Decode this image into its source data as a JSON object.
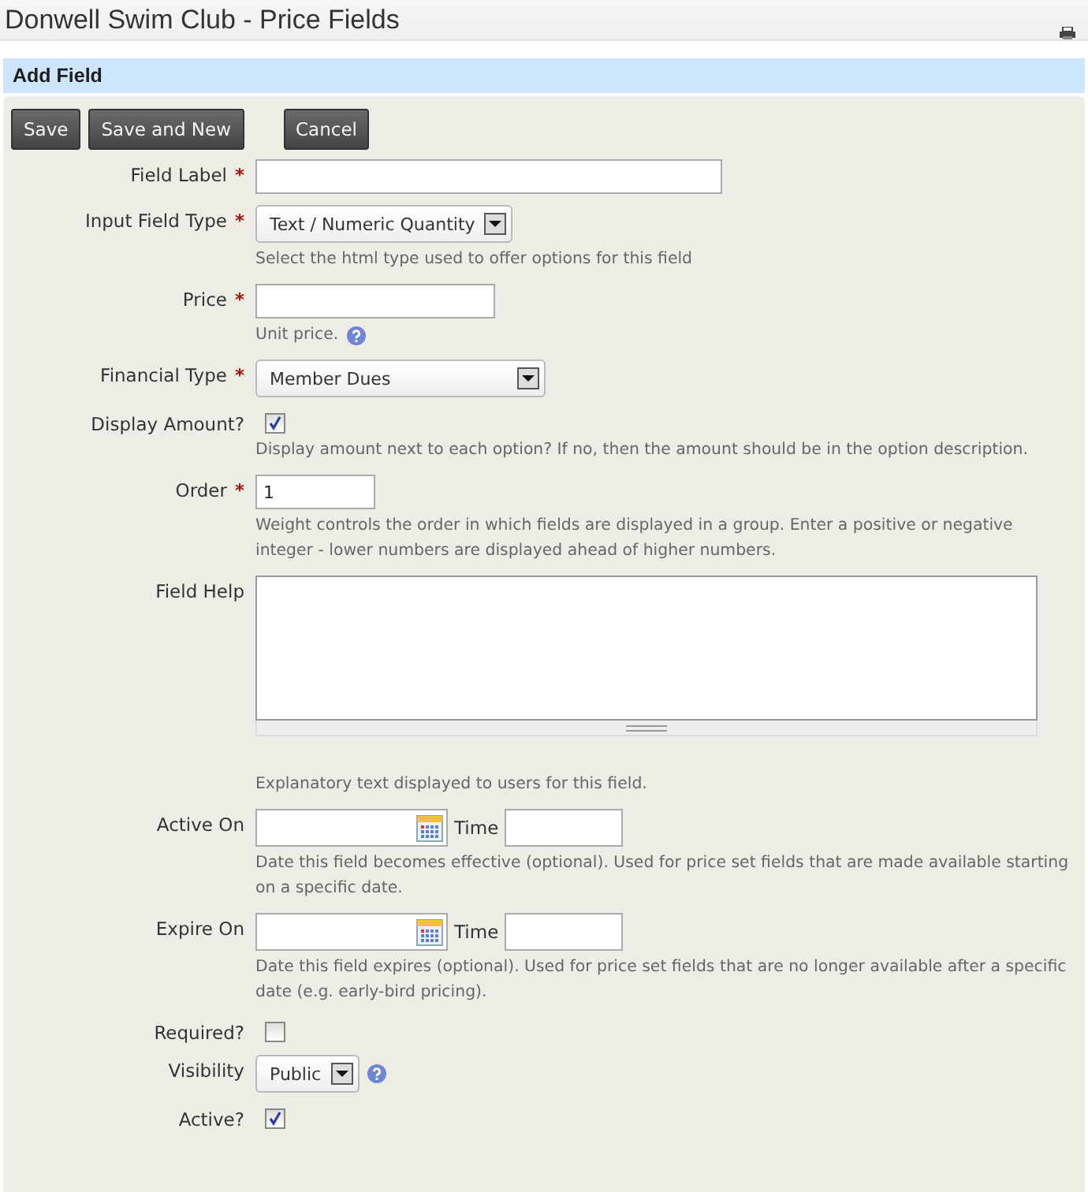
{
  "page_title": "Donwell Swim Club - Price Fields",
  "section": {
    "title": "Add Field"
  },
  "buttons": [
    {
      "label": "Save"
    },
    {
      "label": "Save and New"
    },
    {
      "label": "Cancel"
    }
  ],
  "fields": [
    {
      "label": "Field Label",
      "mark": "*",
      "kind": "long-text"
    },
    {
      "label": "Input Field Type",
      "mark": "*",
      "kind": "select",
      "value": "Text / Numeric Quantity",
      "help": "Select the html type used to offer options for this field"
    },
    {
      "label": "Price",
      "mark": "*",
      "kind": "medium-text",
      "help": "Unit price.",
      "help_icon": true
    },
    {
      "label": "Financial Type",
      "mark": "*",
      "kind": "wide-select",
      "value": "Member Dues"
    },
    {
      "label": "Display Amount?",
      "kind": "checkbox",
      "checked": true,
      "help": "Display amount next to each option? If no, then the amount should be in the option description."
    },
    {
      "label": "Order",
      "mark": "*",
      "kind": "short-text",
      "value": "1",
      "help": "Weight controls the order in which fields are displayed in a group. Enter a positive or negative integer - lower numbers are displayed ahead of higher numbers."
    },
    {
      "label": "Field Help",
      "kind": "textarea",
      "help": "Explanatory text displayed to users for this field."
    },
    {
      "label": "Active On",
      "kind": "datetime",
      "time_label": "Time",
      "help": "Date this field becomes effective (optional). Used for price set fields that are made available starting on a specific date."
    },
    {
      "label": "Expire On",
      "kind": "datetime",
      "time_label": "Time",
      "help": "Date this field expires (optional). Used for price set fields that are no longer available after a specific date (e.g. early-bird pricing)."
    },
    {
      "label": "Required?",
      "kind": "checkbox",
      "checked": false
    },
    {
      "label": "Visibility",
      "kind": "small-select",
      "value": "Public",
      "field_icon": true
    },
    {
      "label": "Active?",
      "kind": "checkbox",
      "checked": true
    }
  ]
}
